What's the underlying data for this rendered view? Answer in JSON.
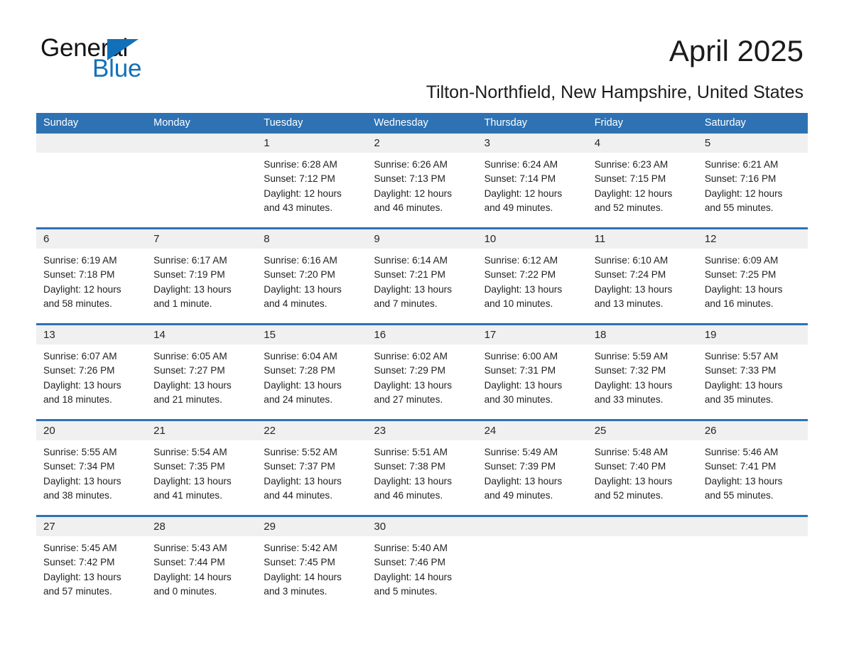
{
  "brand": {
    "word_one": "General",
    "word_two": "Blue",
    "primary_color": "#1270b8",
    "triangle_icon": "triangle-icon"
  },
  "header": {
    "month_title": "April 2025",
    "location": "Tilton-Northfield, New Hampshire, United States"
  },
  "calendar": {
    "header_bg": "#2e72b4",
    "date_band_bg": "#f0f0f0",
    "weekdays": [
      "Sunday",
      "Monday",
      "Tuesday",
      "Wednesday",
      "Thursday",
      "Friday",
      "Saturday"
    ],
    "weeks": [
      [
        {
          "date": "",
          "empty": true,
          "sunrise": "",
          "sunset": "",
          "daylight_1": "",
          "daylight_2": ""
        },
        {
          "date": "",
          "empty": true,
          "sunrise": "",
          "sunset": "",
          "daylight_1": "",
          "daylight_2": ""
        },
        {
          "date": "1",
          "sunrise": "Sunrise: 6:28 AM",
          "sunset": "Sunset: 7:12 PM",
          "daylight_1": "Daylight: 12 hours",
          "daylight_2": "and 43 minutes."
        },
        {
          "date": "2",
          "sunrise": "Sunrise: 6:26 AM",
          "sunset": "Sunset: 7:13 PM",
          "daylight_1": "Daylight: 12 hours",
          "daylight_2": "and 46 minutes."
        },
        {
          "date": "3",
          "sunrise": "Sunrise: 6:24 AM",
          "sunset": "Sunset: 7:14 PM",
          "daylight_1": "Daylight: 12 hours",
          "daylight_2": "and 49 minutes."
        },
        {
          "date": "4",
          "sunrise": "Sunrise: 6:23 AM",
          "sunset": "Sunset: 7:15 PM",
          "daylight_1": "Daylight: 12 hours",
          "daylight_2": "and 52 minutes."
        },
        {
          "date": "5",
          "sunrise": "Sunrise: 6:21 AM",
          "sunset": "Sunset: 7:16 PM",
          "daylight_1": "Daylight: 12 hours",
          "daylight_2": "and 55 minutes."
        }
      ],
      [
        {
          "date": "6",
          "sunrise": "Sunrise: 6:19 AM",
          "sunset": "Sunset: 7:18 PM",
          "daylight_1": "Daylight: 12 hours",
          "daylight_2": "and 58 minutes."
        },
        {
          "date": "7",
          "sunrise": "Sunrise: 6:17 AM",
          "sunset": "Sunset: 7:19 PM",
          "daylight_1": "Daylight: 13 hours",
          "daylight_2": "and 1 minute."
        },
        {
          "date": "8",
          "sunrise": "Sunrise: 6:16 AM",
          "sunset": "Sunset: 7:20 PM",
          "daylight_1": "Daylight: 13 hours",
          "daylight_2": "and 4 minutes."
        },
        {
          "date": "9",
          "sunrise": "Sunrise: 6:14 AM",
          "sunset": "Sunset: 7:21 PM",
          "daylight_1": "Daylight: 13 hours",
          "daylight_2": "and 7 minutes."
        },
        {
          "date": "10",
          "sunrise": "Sunrise: 6:12 AM",
          "sunset": "Sunset: 7:22 PM",
          "daylight_1": "Daylight: 13 hours",
          "daylight_2": "and 10 minutes."
        },
        {
          "date": "11",
          "sunrise": "Sunrise: 6:10 AM",
          "sunset": "Sunset: 7:24 PM",
          "daylight_1": "Daylight: 13 hours",
          "daylight_2": "and 13 minutes."
        },
        {
          "date": "12",
          "sunrise": "Sunrise: 6:09 AM",
          "sunset": "Sunset: 7:25 PM",
          "daylight_1": "Daylight: 13 hours",
          "daylight_2": "and 16 minutes."
        }
      ],
      [
        {
          "date": "13",
          "sunrise": "Sunrise: 6:07 AM",
          "sunset": "Sunset: 7:26 PM",
          "daylight_1": "Daylight: 13 hours",
          "daylight_2": "and 18 minutes."
        },
        {
          "date": "14",
          "sunrise": "Sunrise: 6:05 AM",
          "sunset": "Sunset: 7:27 PM",
          "daylight_1": "Daylight: 13 hours",
          "daylight_2": "and 21 minutes."
        },
        {
          "date": "15",
          "sunrise": "Sunrise: 6:04 AM",
          "sunset": "Sunset: 7:28 PM",
          "daylight_1": "Daylight: 13 hours",
          "daylight_2": "and 24 minutes."
        },
        {
          "date": "16",
          "sunrise": "Sunrise: 6:02 AM",
          "sunset": "Sunset: 7:29 PM",
          "daylight_1": "Daylight: 13 hours",
          "daylight_2": "and 27 minutes."
        },
        {
          "date": "17",
          "sunrise": "Sunrise: 6:00 AM",
          "sunset": "Sunset: 7:31 PM",
          "daylight_1": "Daylight: 13 hours",
          "daylight_2": "and 30 minutes."
        },
        {
          "date": "18",
          "sunrise": "Sunrise: 5:59 AM",
          "sunset": "Sunset: 7:32 PM",
          "daylight_1": "Daylight: 13 hours",
          "daylight_2": "and 33 minutes."
        },
        {
          "date": "19",
          "sunrise": "Sunrise: 5:57 AM",
          "sunset": "Sunset: 7:33 PM",
          "daylight_1": "Daylight: 13 hours",
          "daylight_2": "and 35 minutes."
        }
      ],
      [
        {
          "date": "20",
          "sunrise": "Sunrise: 5:55 AM",
          "sunset": "Sunset: 7:34 PM",
          "daylight_1": "Daylight: 13 hours",
          "daylight_2": "and 38 minutes."
        },
        {
          "date": "21",
          "sunrise": "Sunrise: 5:54 AM",
          "sunset": "Sunset: 7:35 PM",
          "daylight_1": "Daylight: 13 hours",
          "daylight_2": "and 41 minutes."
        },
        {
          "date": "22",
          "sunrise": "Sunrise: 5:52 AM",
          "sunset": "Sunset: 7:37 PM",
          "daylight_1": "Daylight: 13 hours",
          "daylight_2": "and 44 minutes."
        },
        {
          "date": "23",
          "sunrise": "Sunrise: 5:51 AM",
          "sunset": "Sunset: 7:38 PM",
          "daylight_1": "Daylight: 13 hours",
          "daylight_2": "and 46 minutes."
        },
        {
          "date": "24",
          "sunrise": "Sunrise: 5:49 AM",
          "sunset": "Sunset: 7:39 PM",
          "daylight_1": "Daylight: 13 hours",
          "daylight_2": "and 49 minutes."
        },
        {
          "date": "25",
          "sunrise": "Sunrise: 5:48 AM",
          "sunset": "Sunset: 7:40 PM",
          "daylight_1": "Daylight: 13 hours",
          "daylight_2": "and 52 minutes."
        },
        {
          "date": "26",
          "sunrise": "Sunrise: 5:46 AM",
          "sunset": "Sunset: 7:41 PM",
          "daylight_1": "Daylight: 13 hours",
          "daylight_2": "and 55 minutes."
        }
      ],
      [
        {
          "date": "27",
          "sunrise": "Sunrise: 5:45 AM",
          "sunset": "Sunset: 7:42 PM",
          "daylight_1": "Daylight: 13 hours",
          "daylight_2": "and 57 minutes."
        },
        {
          "date": "28",
          "sunrise": "Sunrise: 5:43 AM",
          "sunset": "Sunset: 7:44 PM",
          "daylight_1": "Daylight: 14 hours",
          "daylight_2": "and 0 minutes."
        },
        {
          "date": "29",
          "sunrise": "Sunrise: 5:42 AM",
          "sunset": "Sunset: 7:45 PM",
          "daylight_1": "Daylight: 14 hours",
          "daylight_2": "and 3 minutes."
        },
        {
          "date": "30",
          "sunrise": "Sunrise: 5:40 AM",
          "sunset": "Sunset: 7:46 PM",
          "daylight_1": "Daylight: 14 hours",
          "daylight_2": "and 5 minutes."
        },
        {
          "date": "",
          "empty": true,
          "sunrise": "",
          "sunset": "",
          "daylight_1": "",
          "daylight_2": ""
        },
        {
          "date": "",
          "empty": true,
          "sunrise": "",
          "sunset": "",
          "daylight_1": "",
          "daylight_2": ""
        },
        {
          "date": "",
          "empty": true,
          "sunrise": "",
          "sunset": "",
          "daylight_1": "",
          "daylight_2": ""
        }
      ]
    ]
  }
}
